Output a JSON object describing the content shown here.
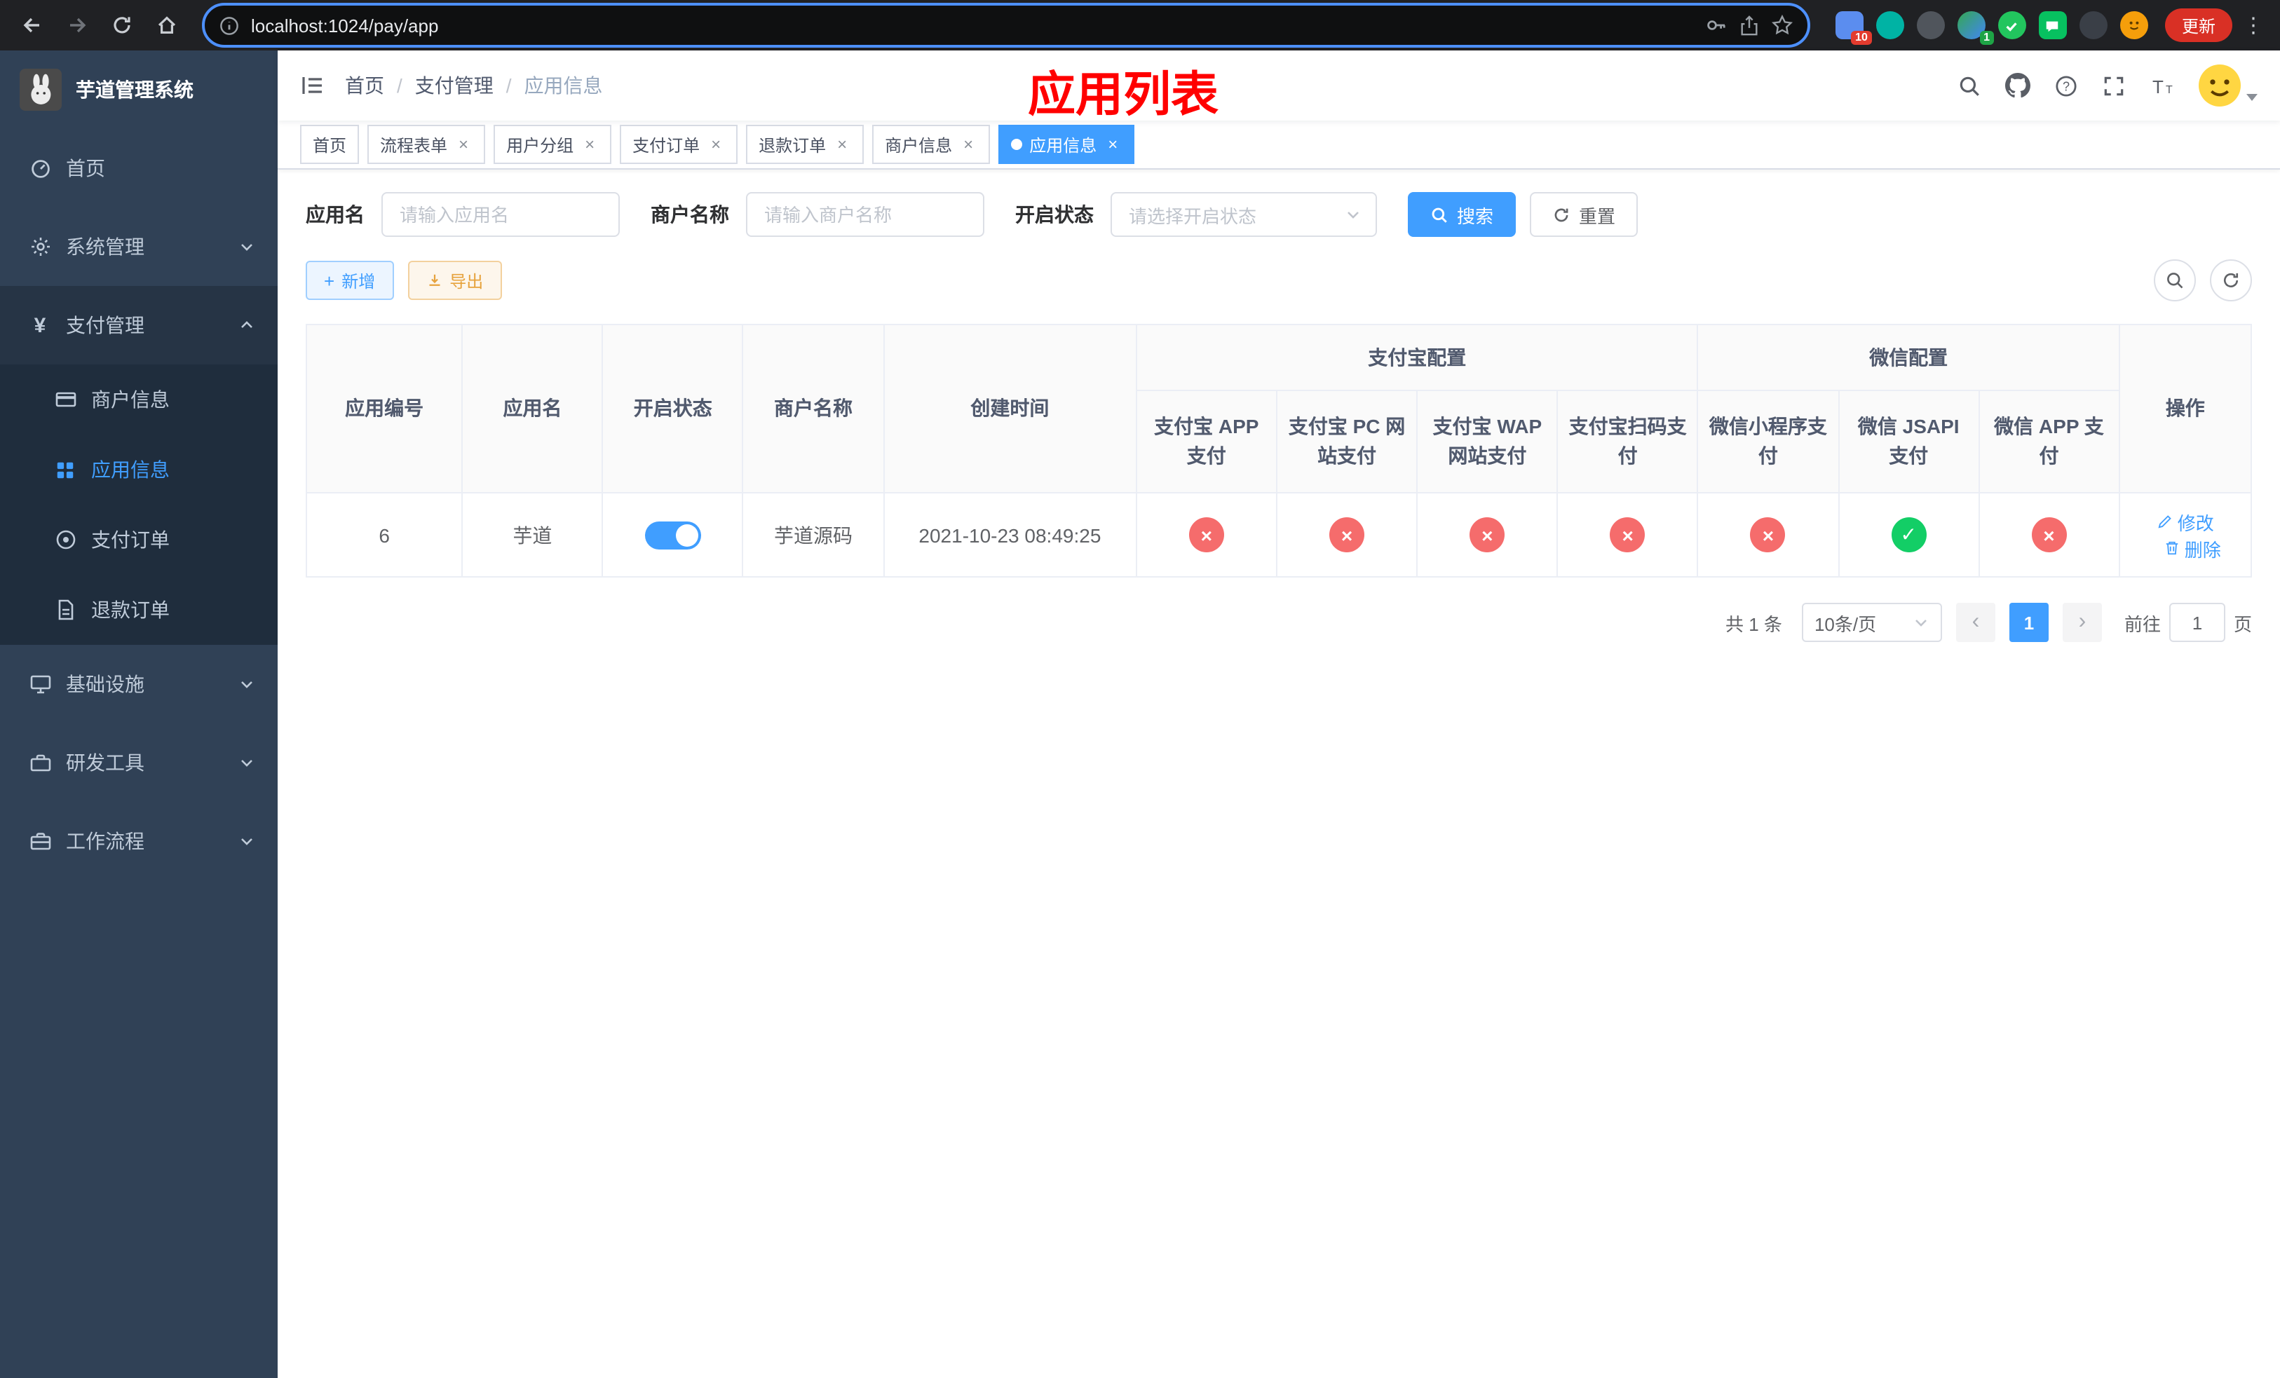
{
  "colors": {
    "accent": "#409eff",
    "status_off_red": "#f56c6c",
    "status_on_green": "#13ce66",
    "annotation_red": "#ff0000",
    "sidebar_bg": "#304156",
    "submenu_bg": "#1f2d3d"
  },
  "browser": {
    "url": "localhost:1024/pay/app",
    "update_label": "更新",
    "extensions_badge_a": "10",
    "extensions_badge_b": "1"
  },
  "sidebar": {
    "title": "芋道管理系统",
    "items": [
      {
        "label": "首页"
      },
      {
        "label": "系统管理"
      },
      {
        "label": "支付管理"
      },
      {
        "label": "基础设施"
      },
      {
        "label": "研发工具"
      },
      {
        "label": "工作流程"
      }
    ],
    "payment_submenu": [
      {
        "label": "商户信息"
      },
      {
        "label": "应用信息"
      },
      {
        "label": "支付订单"
      },
      {
        "label": "退款订单"
      }
    ]
  },
  "header": {
    "breadcrumb": [
      "首页",
      "支付管理",
      "应用信息"
    ],
    "annotation": "应用列表"
  },
  "tabs": [
    {
      "label": "首页"
    },
    {
      "label": "流程表单"
    },
    {
      "label": "用户分组"
    },
    {
      "label": "支付订单"
    },
    {
      "label": "退款订单"
    },
    {
      "label": "商户信息"
    },
    {
      "label": "应用信息"
    }
  ],
  "filters": {
    "app_name_label": "应用名",
    "app_name_placeholder": "请输入应用名",
    "merchant_label": "商户名称",
    "merchant_placeholder": "请输入商户名称",
    "status_label": "开启状态",
    "status_placeholder": "请选择开启状态",
    "search_label": "搜索",
    "reset_label": "重置"
  },
  "toolbar": {
    "add_label": "新增",
    "export_label": "导出"
  },
  "table": {
    "groups": {
      "alipay": "支付宝配置",
      "wechat": "微信配置"
    },
    "columns": {
      "id": "应用编号",
      "name": "应用名",
      "status": "开启状态",
      "merchant": "商户名称",
      "created": "创建时间",
      "alipay_app": "支付宝 APP 支付",
      "alipay_pc": "支付宝 PC 网站支付",
      "alipay_wap": "支付宝 WAP 网站支付",
      "alipay_qr": "支付宝扫码支付",
      "wx_mini": "微信小程序支付",
      "wx_jsapi": "微信 JSAPI 支付",
      "wx_app": "微信 APP 支付",
      "actions": "操作"
    },
    "rows": [
      {
        "id": "6",
        "name": "芋道",
        "enabled": true,
        "merchant": "芋道源码",
        "created": "2021-10-23 08:49:25",
        "alipay_app": false,
        "alipay_pc": false,
        "alipay_wap": false,
        "alipay_qr": false,
        "wx_mini": false,
        "wx_jsapi": true,
        "wx_app": false
      }
    ],
    "actions": {
      "edit": "修改",
      "delete": "删除"
    }
  },
  "pagination": {
    "total": "共 1 条",
    "page_size": "10条/页",
    "page": "1",
    "goto_prefix": "前往",
    "goto_value": "1",
    "goto_suffix": "页"
  }
}
